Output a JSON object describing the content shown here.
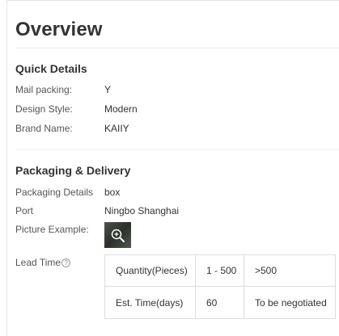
{
  "page": {
    "title": "Overview"
  },
  "quick_details": {
    "heading": "Quick Details",
    "rows": [
      {
        "label": "Mail packing:",
        "value": "Y"
      },
      {
        "label": "Design Style:",
        "value": "Modern"
      },
      {
        "label": "Brand Name:",
        "value": "KAIIY"
      }
    ]
  },
  "packaging": {
    "heading": "Packaging & Delivery",
    "rows": [
      {
        "label": "Packaging Details",
        "value": "box"
      },
      {
        "label": "Port",
        "value": "Ningbo Shanghai"
      }
    ],
    "picture_label": "Picture Example:",
    "picture_icon": "zoom-in-icon",
    "lead_time_label": "Lead Time",
    "help_icon": "?",
    "lead_table": {
      "rows": [
        [
          "Quantity(Pieces)",
          "1 - 500",
          ">500"
        ],
        [
          "Est. Time(days)",
          "60",
          "To be negotiated"
        ]
      ]
    }
  }
}
